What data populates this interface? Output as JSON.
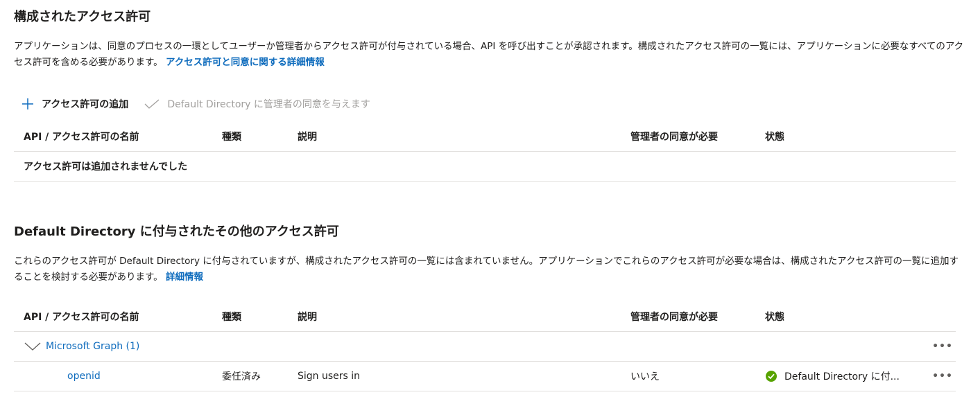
{
  "configured": {
    "title": "構成されたアクセス許可",
    "description": "アプリケーションは、同意のプロセスの一環としてユーザーか管理者からアクセス許可が付与されている場合、API を呼び出すことが承認されます。構成されたアクセス許可の一覧には、アプリケーションに必要なすべてのアクセス許可を含める必要があります。",
    "link": "アクセス許可と同意に関する詳細情報",
    "toolbar": {
      "add_label": "アクセス許可の追加",
      "grant_label": "Default Directory に管理者の同意を与えます"
    },
    "columns": [
      "API / アクセス許可の名前",
      "種類",
      "説明",
      "管理者の同意が必要",
      "状態"
    ],
    "empty_message": "アクセス許可は追加されませんでした"
  },
  "other": {
    "title": "Default Directory に付与されたその他のアクセス許可",
    "description": "これらのアクセス許可が Default Directory に付与されていますが、構成されたアクセス許可の一覧には含まれていません。アプリケーションでこれらのアクセス許可が必要な場合は、構成されたアクセス許可の一覧に追加することを検討する必要があります。",
    "link": "詳細情報",
    "columns": [
      "API / アクセス許可の名前",
      "種類",
      "説明",
      "管理者の同意が必要",
      "状態"
    ],
    "group": {
      "label": "Microsoft Graph (1)",
      "more": "•••"
    },
    "permission": {
      "name": "openid",
      "type": "委任済み",
      "description": "Sign users in",
      "admin_consent": "いいえ",
      "status": "Default Directory に付...",
      "more": "•••"
    }
  },
  "colors": {
    "link": "#0f6cbd",
    "success": "#57a300",
    "divider": "#e1dfdd",
    "disabled": "#a19f9d"
  },
  "icons": {
    "add": "plus-icon",
    "grant": "checkmark-icon",
    "expand": "chevron-down-icon",
    "status": "success-check-circle-icon",
    "more": "more-horizontal-icon"
  }
}
